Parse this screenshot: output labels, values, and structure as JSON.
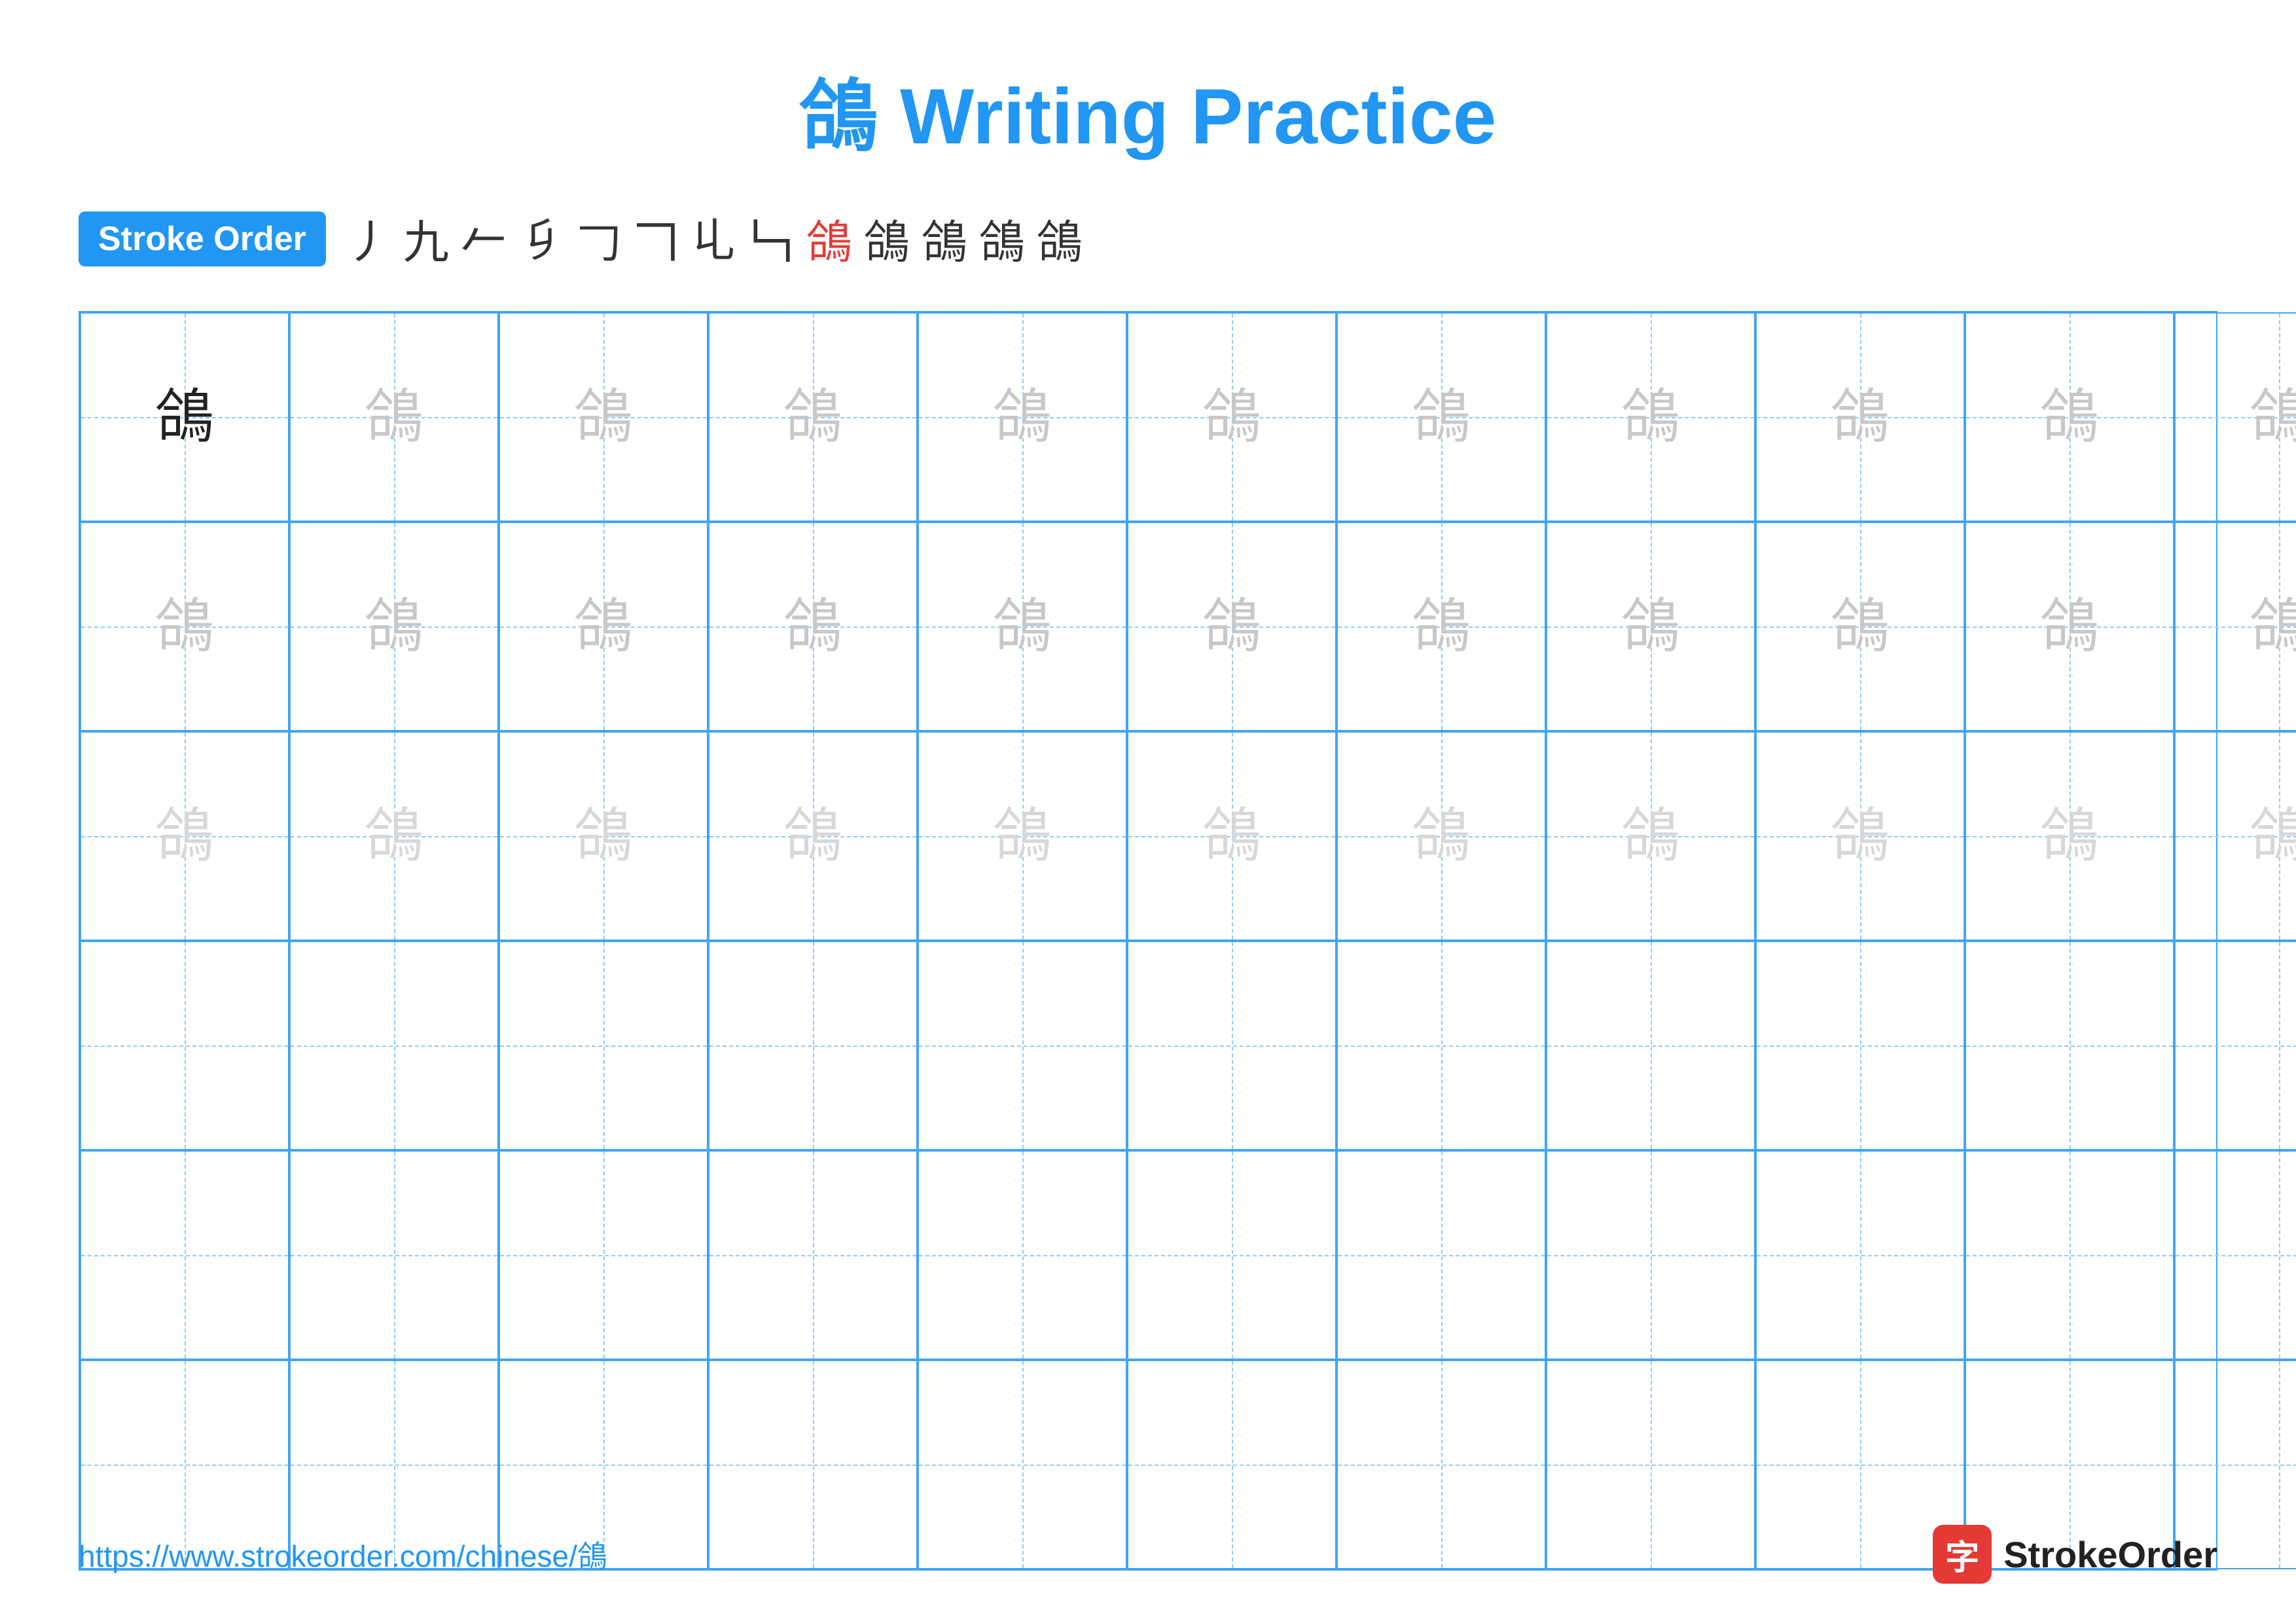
{
  "title": "鴿 Writing Practice",
  "stroke_order": {
    "badge_label": "Stroke Order",
    "strokes": [
      {
        "char": "丿",
        "color": "normal"
      },
      {
        "char": "九",
        "color": "normal"
      },
      {
        "char": "𠂉",
        "color": "normal"
      },
      {
        "char": "𠂎",
        "color": "normal"
      },
      {
        "char": "𠃌",
        "color": "normal"
      },
      {
        "char": "𠃍",
        "color": "normal"
      },
      {
        "char": "𠃏",
        "color": "normal"
      },
      {
        "char": "𠃑",
        "color": "normal"
      },
      {
        "char": "鴿",
        "color": "red"
      },
      {
        "char": "鴿",
        "color": "normal"
      },
      {
        "char": "鴿",
        "color": "normal"
      },
      {
        "char": "鴿",
        "color": "normal"
      },
      {
        "char": "鴿",
        "color": "normal"
      }
    ]
  },
  "practice_char": "鴿",
  "grid": {
    "cols": 13,
    "rows": 6,
    "row_types": [
      "dark_then_light",
      "light",
      "lighter",
      "empty",
      "empty",
      "empty"
    ]
  },
  "footer": {
    "url": "https://www.strokeorder.com/chinese/鴿",
    "logo_icon": "字",
    "logo_text": "StrokeOrder"
  }
}
